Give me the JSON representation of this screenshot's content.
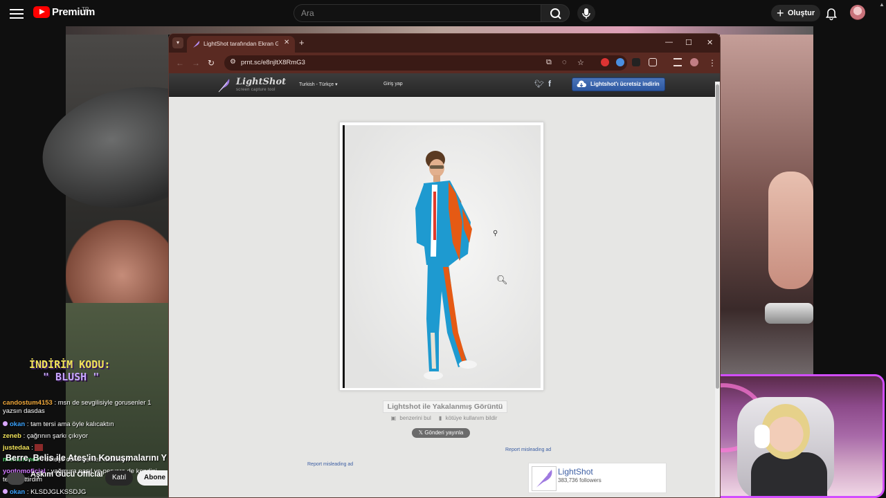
{
  "youtube": {
    "brand": "Premium",
    "region": "TR",
    "search_placeholder": "Ara",
    "create_label": "Oluştur"
  },
  "stream": {
    "promo_line1": "İNDİRİM KODU:",
    "promo_line2": "\" BLUSH \"",
    "chat": [
      {
        "user": "candostum4153",
        "msg": ": msn de sevgilisiyle gorusenler 1 yazsın dasdas",
        "color": "#f2a93b"
      },
      {
        "user": "okan",
        "msg": ": tam tersi ama öyle kalıcaktın",
        "color": "#3aa3ff"
      },
      {
        "user": "zeneb",
        "msg": ": çağrının şarkı çıkıyor",
        "color": "#f2e35a"
      },
      {
        "user": "justedaa",
        "msg": ":",
        "color": "#f2e35a"
      },
      {
        "user": "muhammed",
        "msg": ": beleşe cokomerkez tadilikleri",
        "color": "#4ad36a"
      },
      {
        "user": "yogtomoficial",
        "msg": ": yağmura nasıl ve pervere de kendini tebrik ettirdim",
        "color": "#d27aff"
      },
      {
        "user": "okan",
        "msg": ": KLSDJGLKSSDJG",
        "color": "#3aa3ff"
      }
    ],
    "video_title": "Berre, Belis ile Ateş'in Konuşmalarını Y",
    "channel_name": "Aşkım Gücü Official",
    "join_label": "Katıl",
    "subscribe_label": "Abone ol"
  },
  "browser": {
    "tab_title": "LightShot tarafından Ekran Görüntüsü",
    "url": "prnt.sc/e8njltX8RmG3"
  },
  "lightshot": {
    "logo": "LightShot",
    "logo_sub": "screen capture tool",
    "language": "Turkish - Türkçe",
    "login": "Giriş yap",
    "download": "Lightshot'ı ücretsiz indirin",
    "caption": "Lightshot ile Yakalanmış Görüntü",
    "similar": "benzerini bul",
    "report_abuse": "kötüye kullanım bildir",
    "tweet": "Gönderi yayınla",
    "report_ad": "Report misleading ad",
    "follow_name": "LightShot",
    "follow_count": "383,736 followers"
  },
  "colors": {
    "accent_blue": "#2d57a0",
    "browser_frame": "#3b1c17",
    "cam_border": "#d24dff"
  }
}
